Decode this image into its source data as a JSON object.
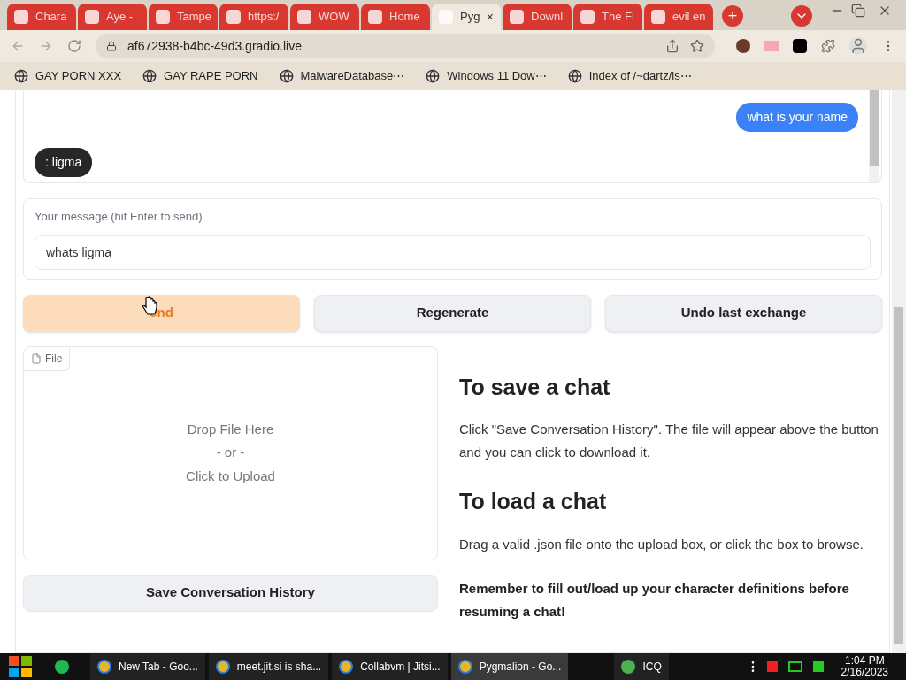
{
  "browser": {
    "tabs": [
      {
        "label": "Chara",
        "selected": false
      },
      {
        "label": "Aye -",
        "selected": false
      },
      {
        "label": "Tampe",
        "selected": false
      },
      {
        "label": "https:/",
        "selected": false
      },
      {
        "label": "WOW",
        "selected": false
      },
      {
        "label": "Home",
        "selected": false
      },
      {
        "label": "Pyg",
        "selected": true,
        "close": "×"
      },
      {
        "label": "Downl",
        "selected": false
      },
      {
        "label": "The Fl",
        "selected": false
      },
      {
        "label": "evil en",
        "selected": false
      }
    ],
    "new_tab": "+",
    "url": "af672938-b4bc-49d3.gradio.live",
    "bookmarks": [
      "GAY PORN XXX",
      "GAY RAPE PORN",
      "MalwareDatabase⋯",
      "Windows 11 Dow⋯",
      "Index of /~dartz/is⋯"
    ]
  },
  "chat": {
    "messages": [
      {
        "kind": "user",
        "text": "what is your name"
      },
      {
        "kind": "bot",
        "text": ": ligma"
      }
    ]
  },
  "message_box": {
    "label": "Your message (hit Enter to send)",
    "value": "whats ligma"
  },
  "buttons": [
    {
      "label": "end",
      "kind": "primary"
    },
    {
      "label": "Regenerate",
      "kind": "secondary"
    },
    {
      "label": "Undo last exchange",
      "kind": "secondary"
    }
  ],
  "upload": {
    "tag": "File",
    "lines": [
      "Drop File Here",
      "- or -",
      "Click to Upload"
    ]
  },
  "save_button": "Save Conversation History",
  "help": [
    {
      "kind": "heading",
      "text": "To save a chat"
    },
    {
      "kind": "para",
      "text": "Click \"Save Conversation History\". The file will appear above the button and you can click to download it."
    },
    {
      "kind": "heading",
      "text": "To load a chat"
    },
    {
      "kind": "para",
      "text": "Drag a valid .json file onto the upload box, or click the box to browse."
    },
    {
      "kind": "bold",
      "text": "Remember to fill out/load up your character definitions before resuming a chat!"
    }
  ],
  "taskbar": {
    "apps": [
      {
        "label": "New Tab - Goo...",
        "selected": false
      },
      {
        "label": "meet.jit.si is sha...",
        "selected": false
      },
      {
        "label": "Collabvm | Jitsi...",
        "selected": false
      },
      {
        "label": "Pygmalion - Go...",
        "selected": true
      },
      {
        "label": "ICQ",
        "selected": false
      }
    ],
    "time": "1:04 PM",
    "date": "2/16/2023"
  }
}
